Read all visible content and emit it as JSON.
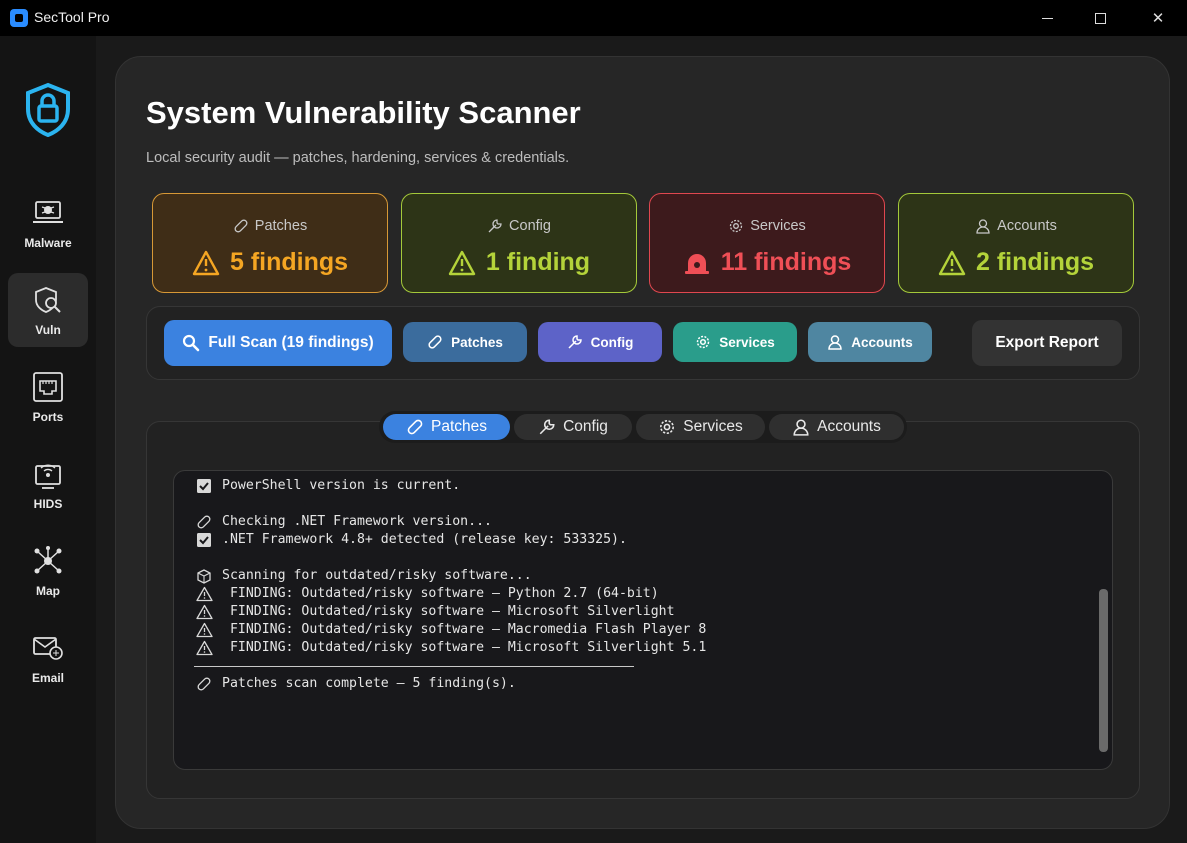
{
  "window": {
    "title": "SecTool Pro",
    "minimize": "—",
    "maximize": "□",
    "close": "✕"
  },
  "sidebar": {
    "logo_icon": "shield-lock-icon",
    "items": [
      {
        "label": "Malware",
        "icon": "laptop-bug-icon",
        "active": false
      },
      {
        "label": "Vuln",
        "icon": "shield-scan-icon",
        "active": true
      },
      {
        "label": "Ports",
        "icon": "ethernet-port-icon",
        "active": false
      },
      {
        "label": "HIDS",
        "icon": "monitor-signal-icon",
        "active": false
      },
      {
        "label": "Map",
        "icon": "network-graph-icon",
        "active": false
      },
      {
        "label": "Email",
        "icon": "email-scan-icon",
        "active": false
      }
    ]
  },
  "header": {
    "title": "System Vulnerability Scanner",
    "subtitle": "Local security audit — patches, hardening, services & credentials."
  },
  "cards": [
    {
      "caption": "Patches",
      "value": "5 findings",
      "icon": "bandage-icon",
      "status_icon": "warning-icon",
      "color": "#f5a623"
    },
    {
      "caption": "Config",
      "value": "1 finding",
      "icon": "wrench-icon",
      "status_icon": "warning-icon",
      "color": "#b4d33a"
    },
    {
      "caption": "Services",
      "value": "11 findings",
      "icon": "gear-icon",
      "status_icon": "siren-icon",
      "color": "#ef4f56"
    },
    {
      "caption": "Accounts",
      "value": "2 findings",
      "icon": "user-icon",
      "status_icon": "warning-icon",
      "color": "#b4d33a"
    }
  ],
  "toolbar": {
    "full_scan": "Full Scan (19 findings)",
    "patches": "Patches",
    "config": "Config",
    "services": "Services",
    "accounts": "Accounts",
    "export": "Export Report"
  },
  "tabs": [
    {
      "label": "Patches",
      "active": true
    },
    {
      "label": "Config",
      "active": false
    },
    {
      "label": "Services",
      "active": false
    },
    {
      "label": "Accounts",
      "active": false
    }
  ],
  "console": {
    "lines": [
      {
        "glyph": "check",
        "text": "PowerShell version is current."
      },
      {
        "glyph": "",
        "text": ""
      },
      {
        "glyph": "bandage",
        "text": "Checking .NET Framework version..."
      },
      {
        "glyph": "check",
        "text": ".NET Framework 4.8+ detected (release key: 533325)."
      },
      {
        "glyph": "",
        "text": ""
      },
      {
        "glyph": "box",
        "text": "Scanning for outdated/risky software..."
      },
      {
        "glyph": "warn",
        "text": " FINDING: Outdated/risky software — Python 2.7 (64-bit)"
      },
      {
        "glyph": "warn",
        "text": " FINDING: Outdated/risky software — Microsoft Silverlight"
      },
      {
        "glyph": "warn",
        "text": " FINDING: Outdated/risky software — Macromedia Flash Player 8"
      },
      {
        "glyph": "warn",
        "text": " FINDING: Outdated/risky software — Microsoft Silverlight 5.1"
      }
    ],
    "footer": "Patches scan complete — 5 finding(s)."
  }
}
